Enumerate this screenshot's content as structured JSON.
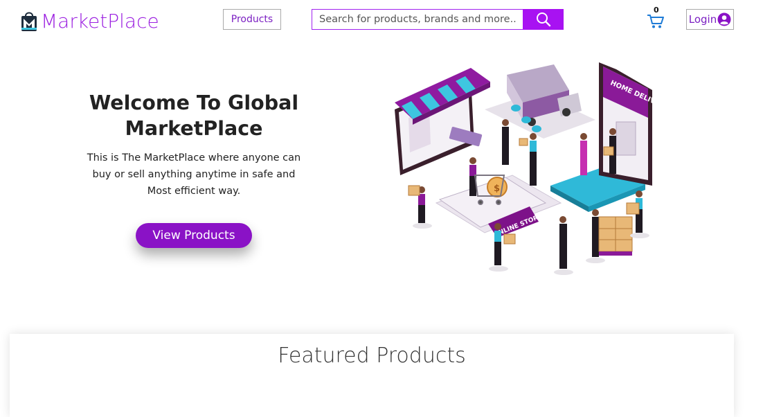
{
  "brand": {
    "name": "MarketPlace",
    "logo_icon": "shopping-bag-m-logo-icon"
  },
  "nav": {
    "products_label": "Products",
    "search_placeholder": "Search for products, brands and more..",
    "search_icon": "search-icon",
    "cart_count": "0",
    "cart_icon": "cart-icon",
    "login_label": "Login",
    "login_icon": "user-circle-icon"
  },
  "hero": {
    "title": "Welcome To Global MarketPlace",
    "description": "This is The MarketPlace where anyone can buy or sell anything anytime in safe and Most efficient way.",
    "cta_label": "View Products",
    "illustration_texts": {
      "delivery_sign": "HOME DELIVERY",
      "store_sign": "ONLINE STORE"
    }
  },
  "featured": {
    "title": "Featured Products"
  },
  "colors": {
    "brand": "#9b1fe0",
    "search_button": "#a812f2",
    "cta": "#8a12c6",
    "cyan": "#3ec6e0"
  }
}
